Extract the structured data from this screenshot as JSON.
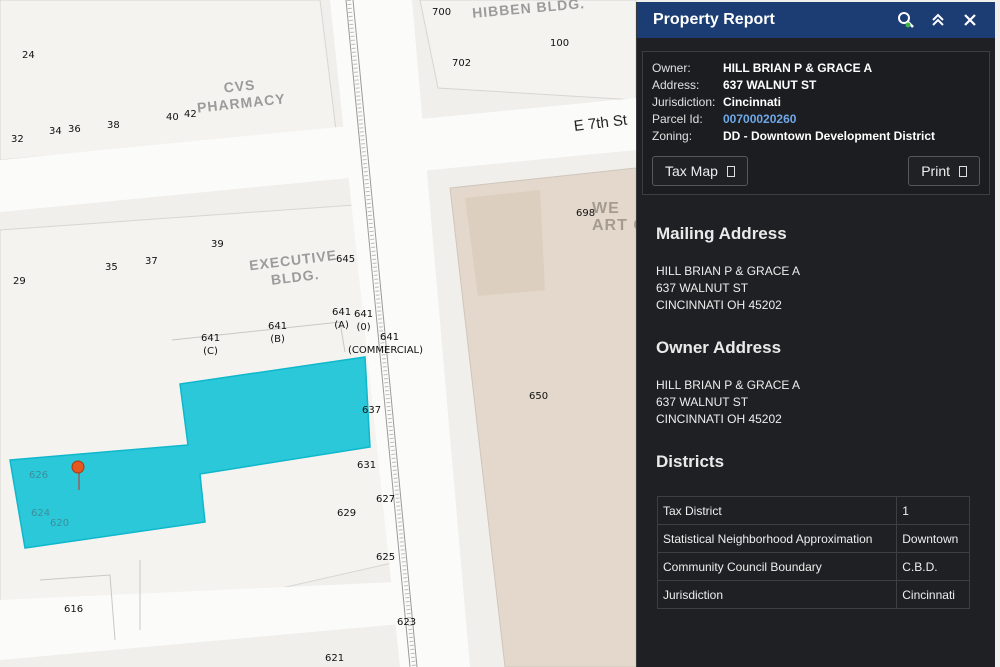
{
  "map": {
    "parcel_numbers": [
      "24",
      "700",
      "100",
      "702",
      "32",
      "34",
      "36",
      "38",
      "40",
      "42",
      "698",
      "39",
      "29",
      "35",
      "37",
      "645",
      "641\n(A)",
      "641\n(0)",
      "641\n(C)",
      "641\n(B)",
      "641",
      "(COMMERCIAL)",
      "650",
      "637",
      "631",
      "627",
      "629",
      "625",
      "616",
      "623",
      "621",
      "626",
      "624",
      "620"
    ],
    "building_labels": [
      "HIBBEN BLDG.",
      "CVS\nPHARMACY",
      "EXECUTIVE\nBLDG.",
      "WE\nART C"
    ],
    "street_label": "E 7th St",
    "highlight_color": "#14c3d6"
  },
  "panel": {
    "title": "Property Report",
    "header_icons": [
      "search-pin-icon",
      "chevron-double-up-icon",
      "close-icon"
    ],
    "summary": {
      "rows": [
        {
          "label": "Owner:",
          "value": "HILL BRIAN P & GRACE A"
        },
        {
          "label": "Address:",
          "value": "637 WALNUT ST"
        },
        {
          "label": "Jurisdiction:",
          "value": "Cincinnati"
        },
        {
          "label": "Parcel Id:",
          "value": "00700020260"
        },
        {
          "label": "Zoning:",
          "value": "DD - Downtown Development District"
        }
      ],
      "tax_map_label": "Tax Map",
      "print_label": "Print"
    },
    "mailing": {
      "title": "Mailing Address",
      "line1": "HILL BRIAN P & GRACE A",
      "line2": "637 WALNUT ST",
      "line3": "CINCINNATI OH 45202"
    },
    "owner": {
      "title": "Owner Address",
      "line1": "HILL BRIAN P & GRACE A",
      "line2": "637 WALNUT ST",
      "line3": "CINCINNATI OH 45202"
    },
    "districts": {
      "title": "Districts",
      "rows": [
        {
          "name": "Tax District",
          "value": "1"
        },
        {
          "name": "Statistical Neighborhood Approximation",
          "value": "Downtown"
        },
        {
          "name": "Community Council Boundary",
          "value": "C.B.D."
        },
        {
          "name": "Jurisdiction",
          "value": "Cincinnati"
        }
      ]
    }
  }
}
